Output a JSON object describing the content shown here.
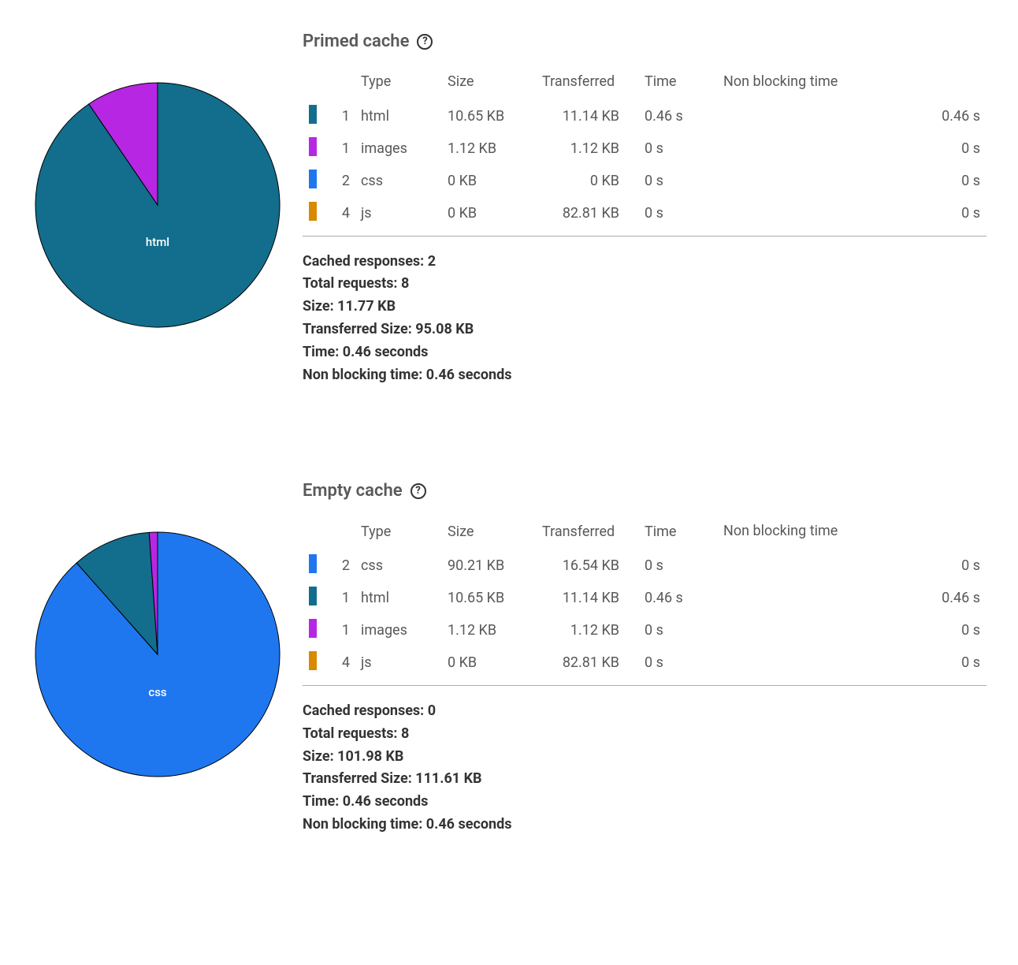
{
  "headers": {
    "type": "Type",
    "size": "Size",
    "transferred": "Transferred",
    "time": "Time",
    "nonblocking": "Non blocking time"
  },
  "colors": {
    "html": "#126e8c",
    "images": "#b727e3",
    "css": "#1f77ef",
    "js": "#d88900"
  },
  "summary_labels": {
    "cached": "Cached responses:",
    "total": "Total requests:",
    "size": "Size:",
    "transferred": "Transferred Size:",
    "time": "Time:",
    "nonblocking": "Non blocking time:"
  },
  "sections": [
    {
      "title": "Primed cache",
      "pie_label": "html",
      "rows": [
        {
          "color": "html",
          "count": "1",
          "type": "html",
          "size": "10.65 KB",
          "transferred": "11.14 KB",
          "time": "0.46 s",
          "nb": "0.46 s"
        },
        {
          "color": "images",
          "count": "1",
          "type": "images",
          "size": "1.12 KB",
          "transferred": "1.12 KB",
          "time": "0 s",
          "nb": "0 s"
        },
        {
          "color": "css",
          "count": "2",
          "type": "css",
          "size": "0 KB",
          "transferred": "0 KB",
          "time": "0 s",
          "nb": "0 s"
        },
        {
          "color": "js",
          "count": "4",
          "type": "js",
          "size": "0 KB",
          "transferred": "82.81 KB",
          "time": "0 s",
          "nb": "0 s"
        }
      ],
      "summary": {
        "cached": "2",
        "total": "8",
        "size": "11.77 KB",
        "transferred": "95.08 KB",
        "time": "0.46 seconds",
        "nonblocking": "0.46 seconds"
      }
    },
    {
      "title": "Empty cache",
      "pie_label": "css",
      "rows": [
        {
          "color": "css",
          "count": "2",
          "type": "css",
          "size": "90.21 KB",
          "transferred": "16.54 KB",
          "time": "0 s",
          "nb": "0 s"
        },
        {
          "color": "html",
          "count": "1",
          "type": "html",
          "size": "10.65 KB",
          "transferred": "11.14 KB",
          "time": "0.46 s",
          "nb": "0.46 s"
        },
        {
          "color": "images",
          "count": "1",
          "type": "images",
          "size": "1.12 KB",
          "transferred": "1.12 KB",
          "time": "0 s",
          "nb": "0 s"
        },
        {
          "color": "js",
          "count": "4",
          "type": "js",
          "size": "0 KB",
          "transferred": "82.81 KB",
          "time": "0 s",
          "nb": "0 s"
        }
      ],
      "summary": {
        "cached": "0",
        "total": "8",
        "size": "101.98 KB",
        "transferred": "111.61 KB",
        "time": "0.46 seconds",
        "nonblocking": "0.46 seconds"
      }
    }
  ],
  "chart_data": [
    {
      "type": "pie",
      "title": "Primed cache — size by type (KB)",
      "slices": [
        {
          "label": "html",
          "value": 10.65,
          "color": "#126e8c"
        },
        {
          "label": "images",
          "value": 1.12,
          "color": "#b727e3"
        },
        {
          "label": "css",
          "value": 0,
          "color": "#1f77ef"
        },
        {
          "label": "js",
          "value": 0,
          "color": "#d88900"
        }
      ],
      "center_label": "html"
    },
    {
      "type": "pie",
      "title": "Empty cache — size by type (KB)",
      "slices": [
        {
          "label": "css",
          "value": 90.21,
          "color": "#1f77ef"
        },
        {
          "label": "html",
          "value": 10.65,
          "color": "#126e8c"
        },
        {
          "label": "images",
          "value": 1.12,
          "color": "#b727e3"
        },
        {
          "label": "js",
          "value": 0,
          "color": "#d88900"
        }
      ],
      "center_label": "css"
    }
  ]
}
